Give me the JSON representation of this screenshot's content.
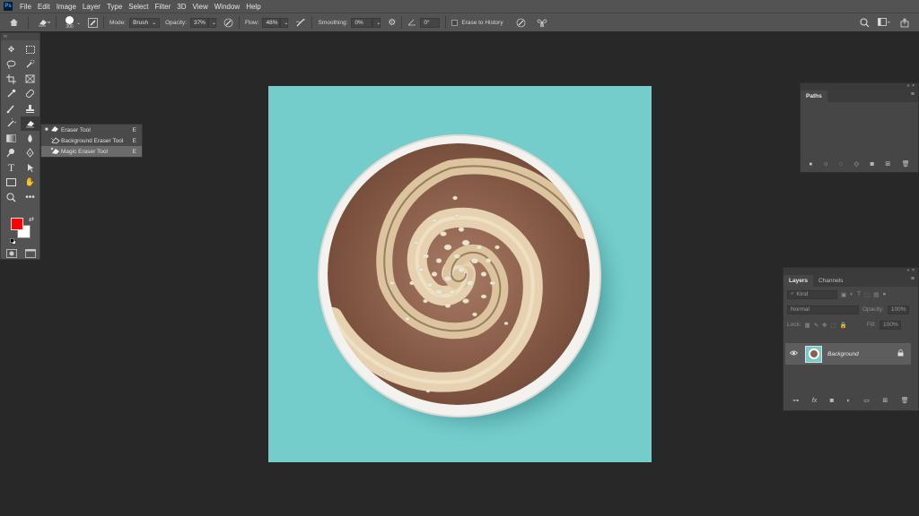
{
  "menubar": {
    "logo": "Ps",
    "items": [
      "File",
      "Edit",
      "Image",
      "Layer",
      "Type",
      "Select",
      "Filter",
      "3D",
      "View",
      "Window",
      "Help"
    ]
  },
  "options": {
    "brush_size": "300",
    "mode_label": "Mode:",
    "mode_value": "Brush",
    "opacity_label": "Opacity:",
    "opacity_value": "37%",
    "flow_label": "Flow:",
    "flow_value": "48%",
    "smoothing_label": "Smoothing:",
    "smoothing_value": "0%",
    "angle_value": "0°",
    "erase_history_label": "Erase to History"
  },
  "flyout": {
    "items": [
      {
        "label": "Eraser Tool",
        "key": "E"
      },
      {
        "label": "Background Eraser Tool",
        "key": "E"
      },
      {
        "label": "Magic Eraser Tool",
        "key": "E"
      }
    ]
  },
  "paths_panel": {
    "tab": "Paths"
  },
  "layers_panel": {
    "tabs": [
      "Layers",
      "Channels"
    ],
    "kind_placeholder": "Kind",
    "blend_mode": "Normal",
    "opacity_label": "Opacity:",
    "opacity_value": "100%",
    "lock_label": "Lock:",
    "fill_label": "Fill:",
    "fill_value": "100%",
    "layer_name": "Background"
  },
  "colors": {
    "foreground": "#ff0000",
    "background": "#ffffff",
    "canvas": "#74cccb"
  }
}
